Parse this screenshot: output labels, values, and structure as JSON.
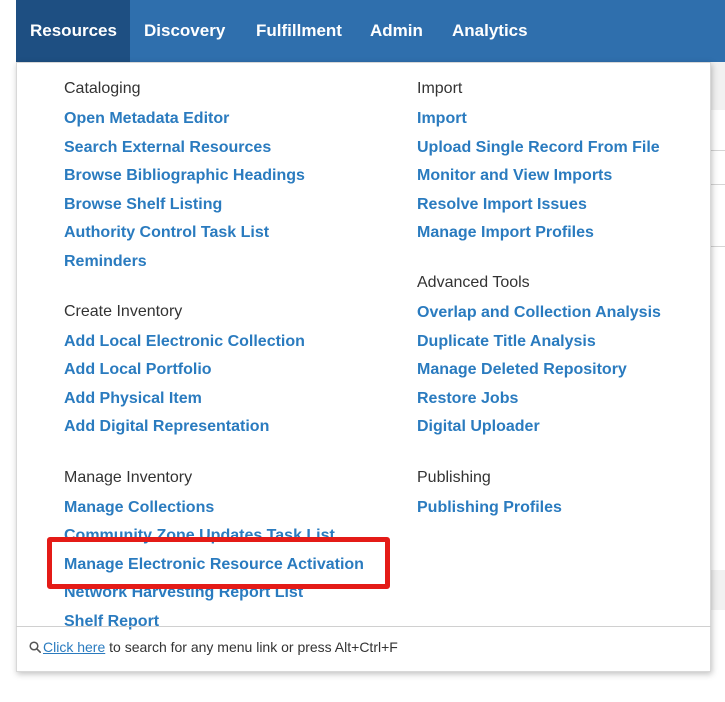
{
  "nav": {
    "tabs": [
      "Resources",
      "Discovery",
      "Fulfillment",
      "Admin",
      "Analytics"
    ],
    "active_tab": "Resources",
    "bg_color": "#2f6fad",
    "active_color": "#1e4f82"
  },
  "menu": {
    "cataloging": {
      "heading": "Cataloging",
      "links": [
        "Open Metadata Editor",
        "Search External Resources",
        "Browse Bibliographic Headings",
        "Browse Shelf Listing",
        "Authority Control Task List",
        "Reminders"
      ]
    },
    "create_inventory": {
      "heading": "Create Inventory",
      "links": [
        "Add Local Electronic Collection",
        "Add Local Portfolio",
        "Add Physical Item",
        "Add Digital Representation"
      ]
    },
    "manage_inventory": {
      "heading": "Manage Inventory",
      "links": [
        "Manage Collections",
        "Community Zone Updates Task List",
        "Manage Electronic Resource Activation",
        "Network Harvesting Report List",
        "Shelf Report"
      ]
    },
    "import": {
      "heading": "Import",
      "links": [
        "Import",
        "Upload Single Record From File",
        "Monitor and View Imports",
        "Resolve Import Issues",
        "Manage Import Profiles"
      ]
    },
    "advanced_tools": {
      "heading": "Advanced Tools",
      "links": [
        "Overlap and Collection Analysis",
        "Duplicate Title Analysis",
        "Manage Deleted Repository",
        "Restore Jobs",
        "Digital Uploader"
      ]
    },
    "publishing": {
      "heading": "Publishing",
      "links": [
        "Publishing Profiles"
      ]
    },
    "link_color": "#2a7bbf",
    "highlighted_link": "Manage Electronic Resource Activation",
    "highlight_color": "#e41b17"
  },
  "footer": {
    "link_text": "Click here",
    "rest_text": " to search for any menu link or press Alt+Ctrl+F"
  }
}
